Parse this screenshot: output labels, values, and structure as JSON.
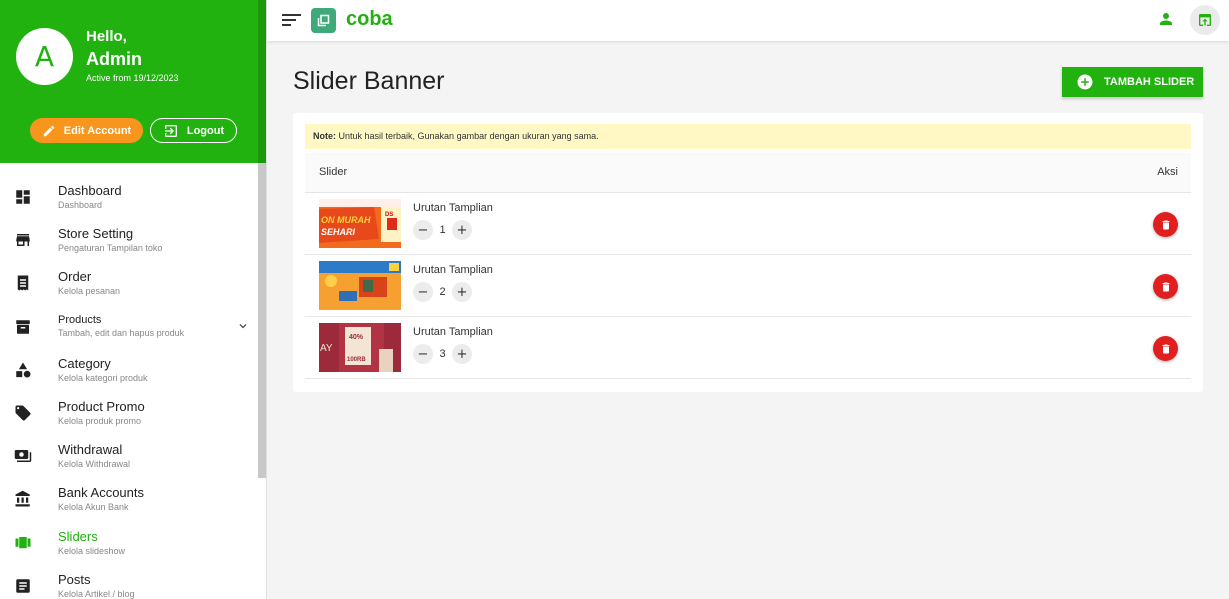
{
  "profile": {
    "avatar_letter": "A",
    "greeting": "Hello,",
    "name": "Admin",
    "active_from": "Active from 19/12/2023",
    "edit_label": "Edit Account",
    "logout_label": "Logout"
  },
  "menu": [
    {
      "label": "Dashboard",
      "sub": "Dashboard",
      "icon": "dashboard-icon"
    },
    {
      "label": "Store Setting",
      "sub": "Pengaturan Tampilan toko",
      "icon": "store-icon"
    },
    {
      "label": "Order",
      "sub": "Kelola pesanan",
      "icon": "receipt-icon"
    },
    {
      "label": "Products",
      "sub": "Tambah, edit dan hapus produk",
      "icon": "archive-icon"
    },
    {
      "label": "Category",
      "sub": "Kelola kategori produk",
      "icon": "shapes-icon"
    },
    {
      "label": "Product Promo",
      "sub": "Kelola produk promo",
      "icon": "tag-icon"
    },
    {
      "label": "Withdrawal",
      "sub": "Kelola Withdrawal",
      "icon": "payments-icon"
    },
    {
      "label": "Bank Accounts",
      "sub": "Kelola Akun Bank",
      "icon": "bank-icon"
    },
    {
      "label": "Sliders",
      "sub": "Kelola slideshow",
      "icon": "carousel-icon"
    },
    {
      "label": "Posts",
      "sub": "Kelola Artikel / blog",
      "icon": "article-icon"
    }
  ],
  "topbar": {
    "brand": "coba"
  },
  "page": {
    "title": "Slider Banner",
    "add_button": "TAMBAH SLIDER",
    "note_bold": "Note:",
    "note_text": " Untuk hasil terbaik, Gunakan gambar dengan ukuran yang sama.",
    "col_slider": "Slider",
    "col_aksi": "Aksi"
  },
  "sliders": [
    {
      "title": "Urutan Tamplian",
      "order": "1",
      "thumb_text": "ON MURAH",
      "thumb_text2": "SEHARI"
    },
    {
      "title": "Urutan Tamplian",
      "order": "2"
    },
    {
      "title": "Urutan Tamplian",
      "order": "3",
      "thumb_text": "40%",
      "thumb_text2": "100RB"
    }
  ],
  "colors": {
    "brand": "#21b20f",
    "orange": "#f7951d",
    "danger": "#e02020",
    "note_bg": "#fff8c4"
  }
}
